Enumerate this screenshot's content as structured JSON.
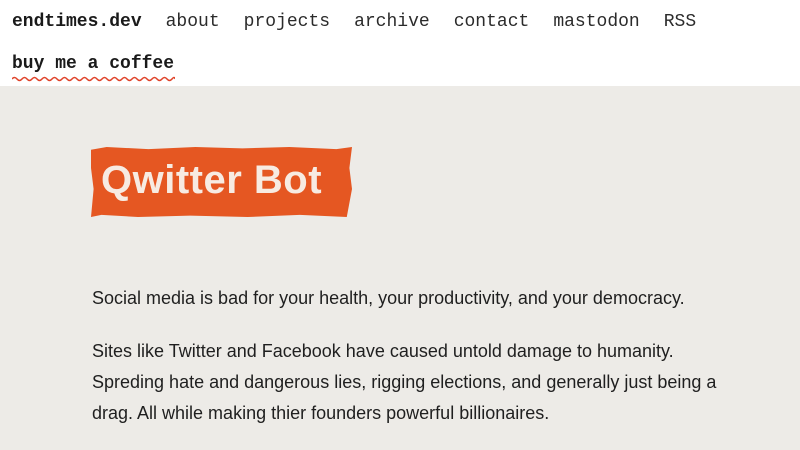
{
  "nav": {
    "brand": "endtimes.dev",
    "links": [
      "about",
      "projects",
      "archive",
      "contact",
      "mastodon",
      "RSS"
    ],
    "coffee": "buy me a coffee"
  },
  "colors": {
    "accent": "#e55722",
    "background": "#edebe7",
    "squiggle": "#e0442b"
  },
  "article": {
    "title": "Qwitter Bot",
    "paragraphs": [
      "Social media is bad for your health, your productivity, and your democracy.",
      "Sites like Twitter and Facebook have caused untold damage to humanity. Spreding hate and dangerous lies, rigging elections, and generally just being a drag. All while making thier founders powerful billionaires."
    ]
  }
}
